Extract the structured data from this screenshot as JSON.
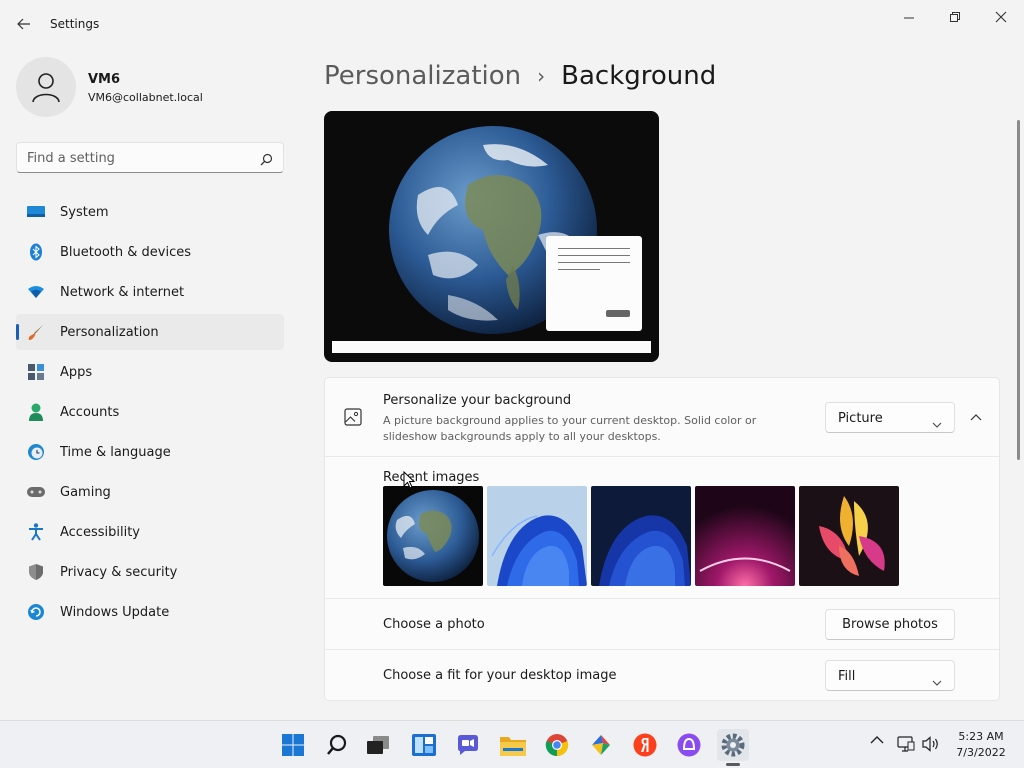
{
  "window": {
    "title": "Settings",
    "controls": [
      "minimize",
      "restore",
      "close"
    ]
  },
  "user": {
    "name": "VM6",
    "email": "VM6@collabnet.local"
  },
  "search": {
    "placeholder": "Find a setting",
    "value": ""
  },
  "nav": {
    "selected": "Personalization",
    "items": [
      {
        "label": "System",
        "icon": "monitor-icon"
      },
      {
        "label": "Bluetooth & devices",
        "icon": "bluetooth-icon"
      },
      {
        "label": "Network & internet",
        "icon": "wifi-icon"
      },
      {
        "label": "Personalization",
        "icon": "brush-icon"
      },
      {
        "label": "Apps",
        "icon": "apps-icon"
      },
      {
        "label": "Accounts",
        "icon": "person-icon"
      },
      {
        "label": "Time & language",
        "icon": "globe-clock-icon"
      },
      {
        "label": "Gaming",
        "icon": "gamepad-icon"
      },
      {
        "label": "Accessibility",
        "icon": "accessibility-icon"
      },
      {
        "label": "Privacy & security",
        "icon": "shield-icon"
      },
      {
        "label": "Windows Update",
        "icon": "update-icon"
      }
    ]
  },
  "breadcrumb": {
    "parent": "Personalization",
    "separator": "›",
    "current": "Background"
  },
  "personalize": {
    "title": "Personalize your background",
    "description": "A picture background applies to your current desktop. Solid color or slideshow backgrounds apply to all your desktops.",
    "selected": "Picture"
  },
  "recent": {
    "label": "Recent images",
    "images": [
      "earth-image",
      "bloom-light-image",
      "bloom-dark-image",
      "purple-glow-image",
      "flower-ribbon-image"
    ]
  },
  "choose_photo": {
    "label": "Choose a photo",
    "button": "Browse photos"
  },
  "fit": {
    "label": "Choose a fit for your desktop image",
    "selected": "Fill"
  },
  "taskbar": {
    "apps": [
      "start-icon",
      "search-icon",
      "task-view-icon",
      "widgets-icon",
      "chat-icon",
      "file-explorer-icon",
      "chrome-icon",
      "app-icon",
      "yandex-icon",
      "alice-icon",
      "settings-icon"
    ],
    "active_app": "settings-icon",
    "tray": [
      "chevron-up-icon",
      "network-icon",
      "volume-icon"
    ],
    "time": "5:23 AM",
    "date": "7/3/2022"
  },
  "colors": {
    "accent": "#1a5fb4",
    "background": "#f3f3f3",
    "card": "#fbfbfb"
  }
}
